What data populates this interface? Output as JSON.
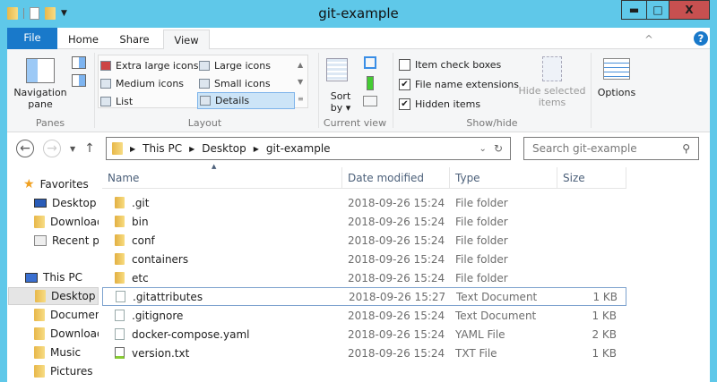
{
  "window": {
    "title": "git-example",
    "minimize": "▬",
    "maximize": "□",
    "close": "X"
  },
  "ribbon": {
    "tabs": [
      "File",
      "Home",
      "Share",
      "View"
    ],
    "active_tab": "View",
    "collapse": "^",
    "help": "?",
    "panes": {
      "navigation_pane": [
        "Navigation",
        "pane"
      ],
      "label": "Panes"
    },
    "layout": {
      "items": [
        "Extra large icons",
        "Large icons",
        "Medium icons",
        "Small icons",
        "List",
        "Details"
      ],
      "selected": "Details",
      "label": "Layout"
    },
    "current_view": {
      "sort_by": [
        "Sort",
        "by ▾"
      ],
      "label": "Current view"
    },
    "show_hide": {
      "checkboxes": [
        {
          "label": "Item check boxes",
          "checked": false
        },
        {
          "label": "File name extensions",
          "checked": true
        },
        {
          "label": "Hidden items",
          "checked": true
        }
      ],
      "hide_selected": [
        "Hide selected",
        "items"
      ],
      "label": "Show/hide"
    },
    "options": "Options"
  },
  "address": {
    "path": [
      "This PC",
      "Desktop",
      "git-example"
    ],
    "search_placeholder": "Search git-example"
  },
  "sidebar": {
    "favorites": "Favorites",
    "fav_items": [
      "Desktop",
      "Downloads",
      "Recent places"
    ],
    "this_pc": "This PC",
    "pc_items": [
      "Desktop",
      "Documents",
      "Downloads",
      "Music",
      "Pictures"
    ],
    "selected": "Desktop"
  },
  "columns": [
    "Name",
    "Date modified",
    "Type",
    "Size"
  ],
  "files": [
    {
      "name": ".git",
      "date": "2018-09-26 15:24",
      "type": "File folder",
      "size": "",
      "icon": "folder"
    },
    {
      "name": "bin",
      "date": "2018-09-26 15:24",
      "type": "File folder",
      "size": "",
      "icon": "folder"
    },
    {
      "name": "conf",
      "date": "2018-09-26 15:24",
      "type": "File folder",
      "size": "",
      "icon": "folder"
    },
    {
      "name": "containers",
      "date": "2018-09-26 15:24",
      "type": "File folder",
      "size": "",
      "icon": "folder"
    },
    {
      "name": "etc",
      "date": "2018-09-26 15:24",
      "type": "File folder",
      "size": "",
      "icon": "folder"
    },
    {
      "name": ".gitattributes",
      "date": "2018-09-26 15:27",
      "type": "Text Document",
      "size": "1 KB",
      "icon": "doc"
    },
    {
      "name": ".gitignore",
      "date": "2018-09-26 15:24",
      "type": "Text Document",
      "size": "1 KB",
      "icon": "doc"
    },
    {
      "name": "docker-compose.yaml",
      "date": "2018-09-26 15:24",
      "type": "YAML File",
      "size": "2 KB",
      "icon": "doc"
    },
    {
      "name": "version.txt",
      "date": "2018-09-26 15:24",
      "type": "TXT File",
      "size": "1 KB",
      "icon": "txt"
    }
  ],
  "focused_file": ".gitattributes",
  "colors": {
    "titlebar": "#5fc8e9",
    "file_tab": "#1979ca",
    "close": "#c75050",
    "selection": "#cce4f7"
  }
}
